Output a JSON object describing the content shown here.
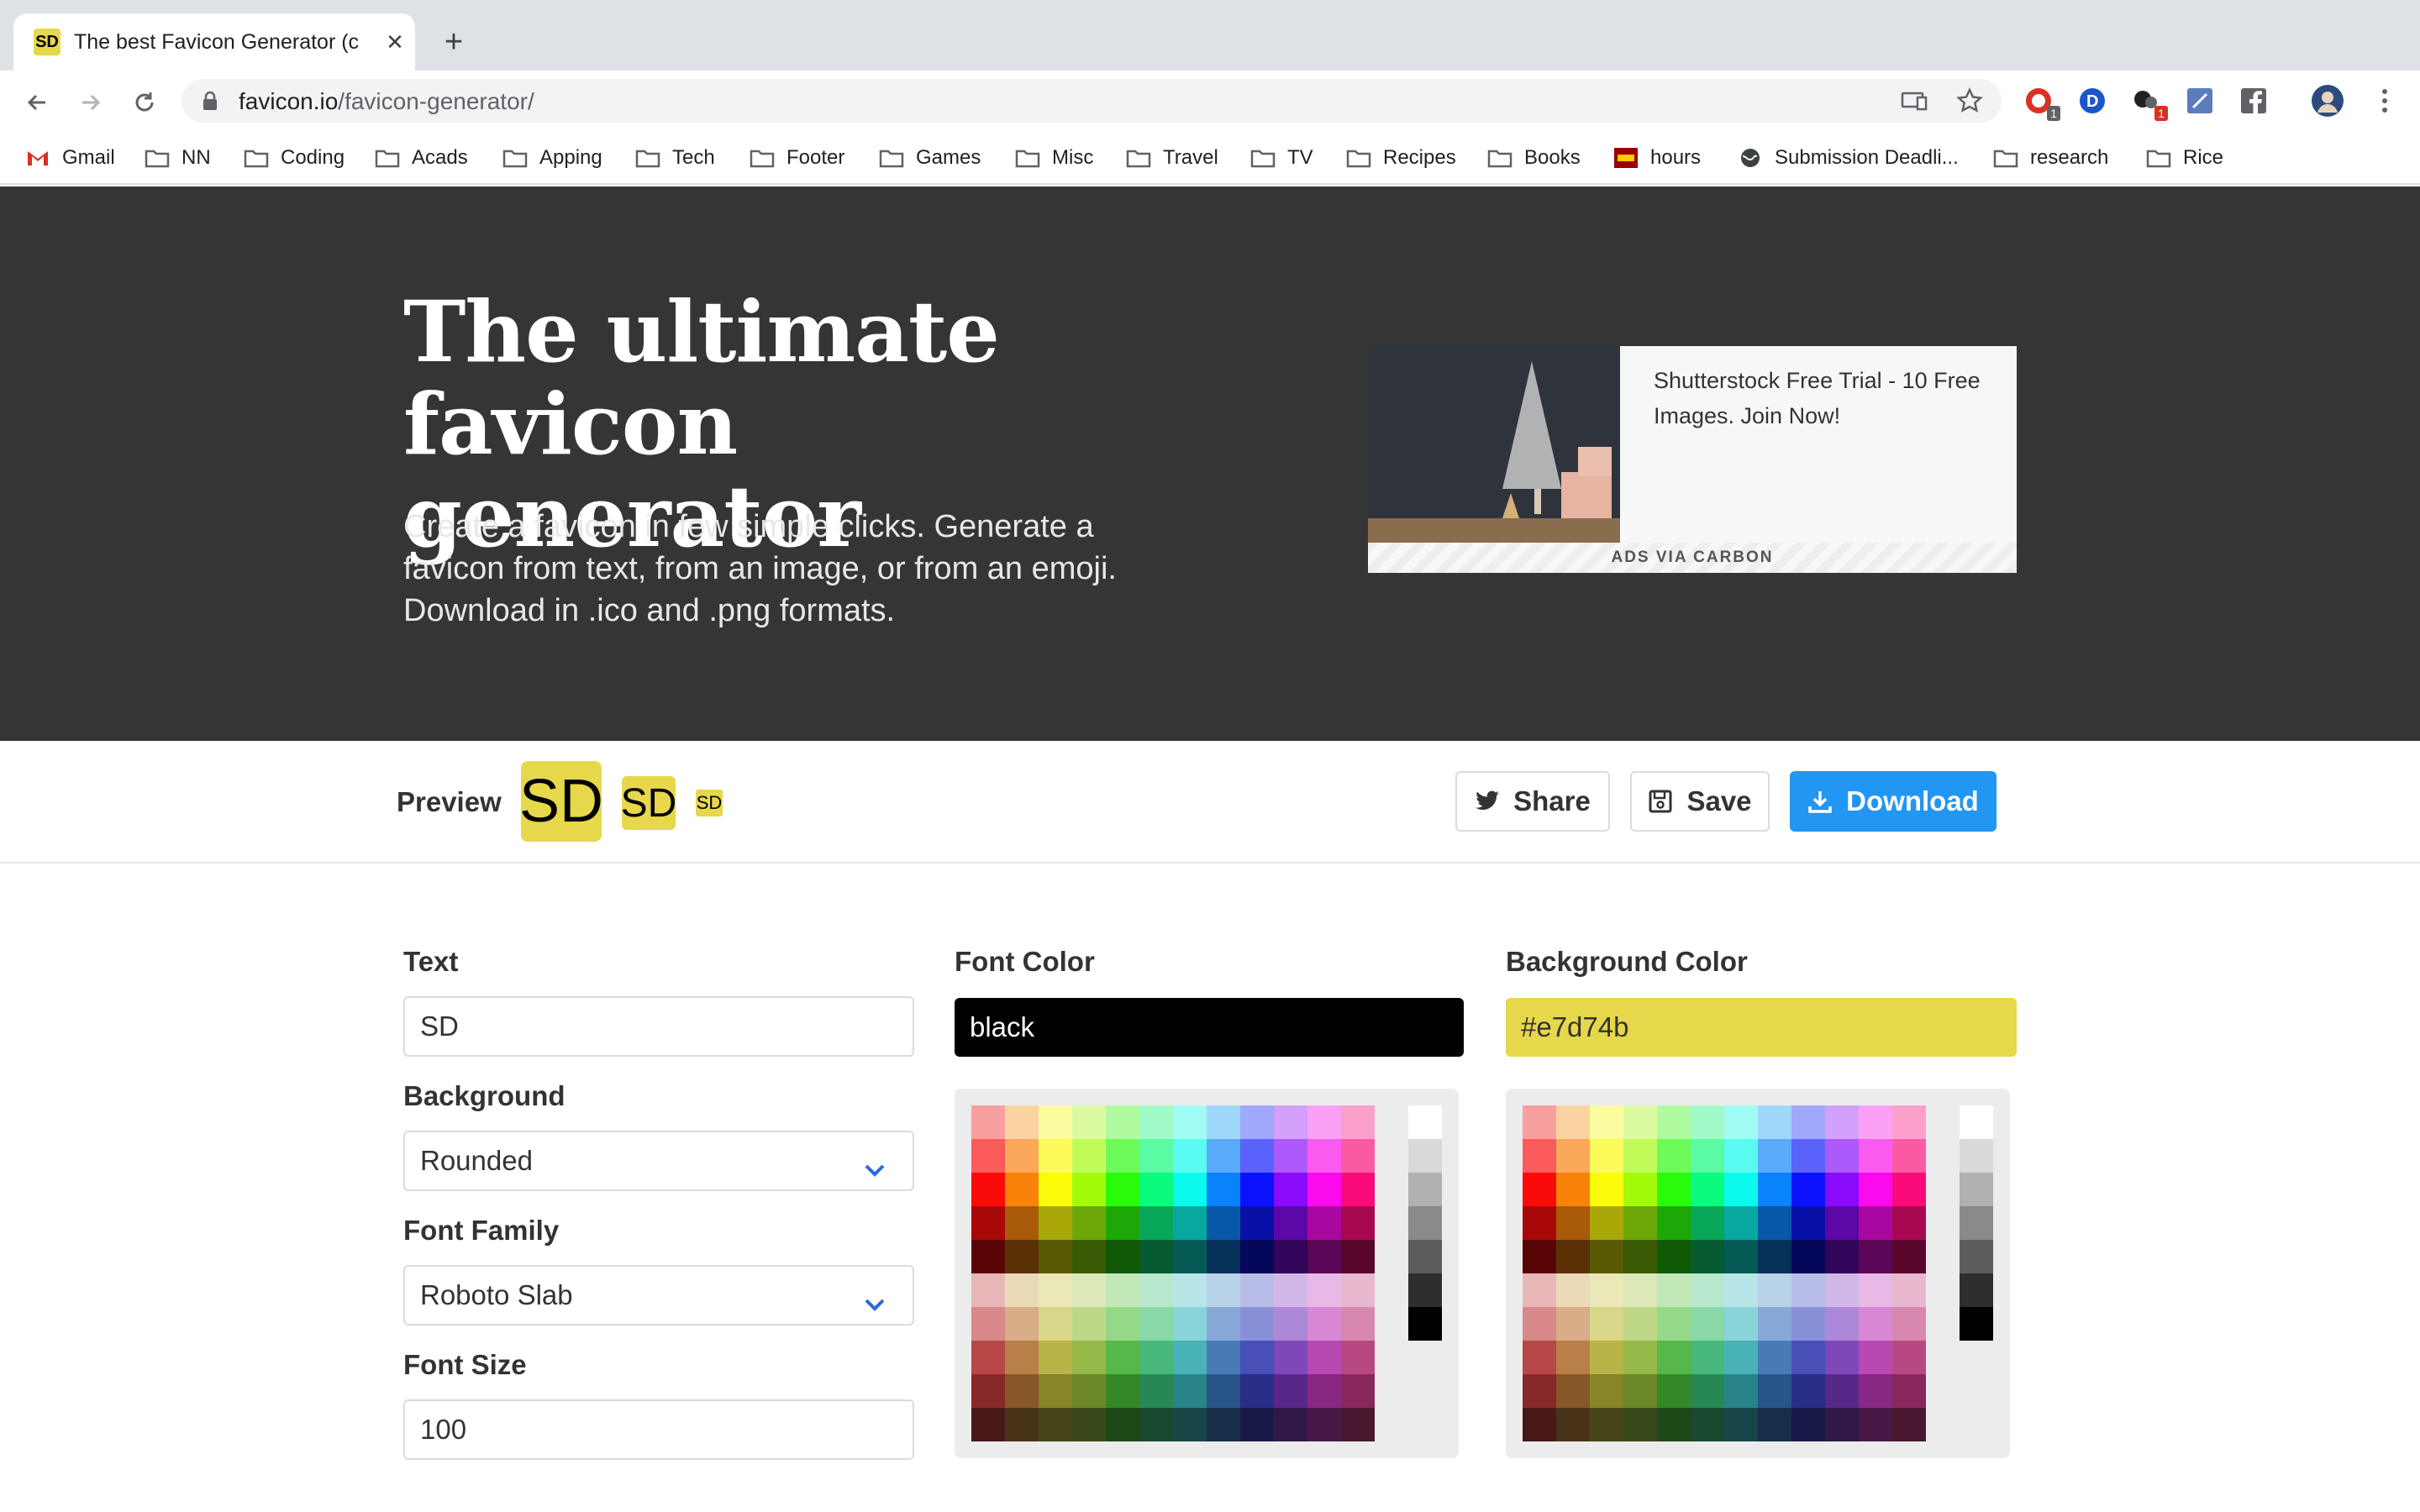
{
  "browser": {
    "tab_favicon": "SD",
    "tab_title": "The best Favicon Generator (c",
    "url_host": "favicon.io",
    "url_path": "/favicon-generator/",
    "bookmarks": [
      {
        "label": "Gmail",
        "icon": "gmail-icon"
      },
      {
        "label": "NN",
        "icon": "folder-icon"
      },
      {
        "label": "Coding",
        "icon": "folder-icon"
      },
      {
        "label": "Acads",
        "icon": "folder-icon"
      },
      {
        "label": "Apping",
        "icon": "folder-icon"
      },
      {
        "label": "Tech",
        "icon": "folder-icon"
      },
      {
        "label": "Footer",
        "icon": "folder-icon"
      },
      {
        "label": "Games",
        "icon": "folder-icon"
      },
      {
        "label": "Misc",
        "icon": "folder-icon"
      },
      {
        "label": "Travel",
        "icon": "folder-icon"
      },
      {
        "label": "TV",
        "icon": "folder-icon"
      },
      {
        "label": "Recipes",
        "icon": "folder-icon"
      },
      {
        "label": "Books",
        "icon": "folder-icon"
      },
      {
        "label": "hours",
        "icon": "usc-icon"
      },
      {
        "label": "Submission Deadli...",
        "icon": "globe-icon"
      },
      {
        "label": "research",
        "icon": "folder-icon"
      },
      {
        "label": "Rice",
        "icon": "folder-icon"
      }
    ],
    "extension_badges": {
      "first": "1",
      "second": "1"
    }
  },
  "hero": {
    "title_line1": "The ultimate",
    "title_line2": "favicon generator",
    "description": "Create a favicon in few simple clicks. Generate a favicon from text, from an image, or from an emoji. Download in .ico and .png formats.",
    "ad_text": "Shutterstock Free Trial - 10 Free Images. Join Now!",
    "ad_footer": "ADS VIA CARBON"
  },
  "preview": {
    "label": "Preview",
    "favicon_text": "SD",
    "share_label": "Share",
    "save_label": "Save",
    "download_label": "Download"
  },
  "form": {
    "text_label": "Text",
    "text_value": "SD",
    "background_label": "Background",
    "background_value": "Rounded",
    "font_family_label": "Font Family",
    "font_family_value": "Roboto Slab",
    "font_size_label": "Font Size",
    "font_size_value": "100",
    "font_color_label": "Font Color",
    "font_color_value": "black",
    "bg_color_label": "Background Color",
    "bg_color_value": "#e7d74b"
  },
  "colors": {
    "favicon_bg": "#e7d74b",
    "hero_bg": "#353535",
    "primary": "#2196f3",
    "palette_rows": [
      [
        "#f8a0a0",
        "#fbd3a0",
        "#fbfba0",
        "#dcfba0",
        "#b0fba0",
        "#a0fbc8",
        "#a0fbf5",
        "#a0d8fb",
        "#a0a8fb",
        "#d3a0fb",
        "#fba0f5",
        "#fba0cb"
      ],
      [
        "#fb5a5a",
        "#fba85a",
        "#fbfb5a",
        "#c0fb5a",
        "#6dfb5a",
        "#5afba2",
        "#5afbf0",
        "#5aaafb",
        "#5a62fb",
        "#ac5afb",
        "#fb5af0",
        "#fb5aa3"
      ],
      [
        "#fb0a0a",
        "#fb820a",
        "#fbfb0a",
        "#a2fb0a",
        "#2afb0a",
        "#0afb7e",
        "#0afbee",
        "#0a82fb",
        "#0a12fb",
        "#8a0afb",
        "#fb0aee",
        "#fb0a7a"
      ],
      [
        "#a80808",
        "#a85a08",
        "#a8a808",
        "#6ea808",
        "#1ea808",
        "#08a858",
        "#08a8a0",
        "#0858a8",
        "#0810a8",
        "#5c08a8",
        "#a808a0",
        "#a80852"
      ],
      [
        "#5a0505",
        "#5a3005",
        "#5a5a05",
        "#3b5a05",
        "#105a05",
        "#055a2f",
        "#055a56",
        "#05305a",
        "#05085a",
        "#31055a",
        "#5a0556",
        "#5a052c"
      ],
      [
        "#e8b8b8",
        "#eadab8",
        "#eae8b8",
        "#dde8b8",
        "#c2e8b8",
        "#b8e8cd",
        "#b8e6e8",
        "#b8d2e8",
        "#b8bde8",
        "#d2b8e8",
        "#e8b8e6",
        "#e8b8cf"
      ],
      [
        "#d88888",
        "#d8ad88",
        "#d8d688",
        "#bfd888",
        "#95d888",
        "#88d8a8",
        "#88d4d8",
        "#88a8d8",
        "#8890d8",
        "#ad88d8",
        "#d888d4",
        "#d888ae"
      ],
      [
        "#b84848",
        "#b87f48",
        "#b8b448",
        "#96b848",
        "#55b848",
        "#48b87a",
        "#48b2b8",
        "#487ab8",
        "#4850b8",
        "#7e48b8",
        "#b848b2",
        "#b84883"
      ],
      [
        "#882828",
        "#885828",
        "#888428",
        "#6c8828",
        "#358828",
        "#288854",
        "#288488",
        "#285488",
        "#282e88",
        "#582888",
        "#882884",
        "#88285c"
      ],
      [
        "#481818",
        "#483218",
        "#484618",
        "#394818",
        "#1d4818",
        "#18482e",
        "#184648",
        "#182e48",
        "#181a48",
        "#301848",
        "#481846",
        "#481830"
      ]
    ],
    "grey_swatches": [
      "#ffffff",
      "#d9d9d9",
      "#b0b0b0",
      "#8a8a8a",
      "#5c5c5c",
      "#2e2e2e",
      "#000000"
    ]
  }
}
